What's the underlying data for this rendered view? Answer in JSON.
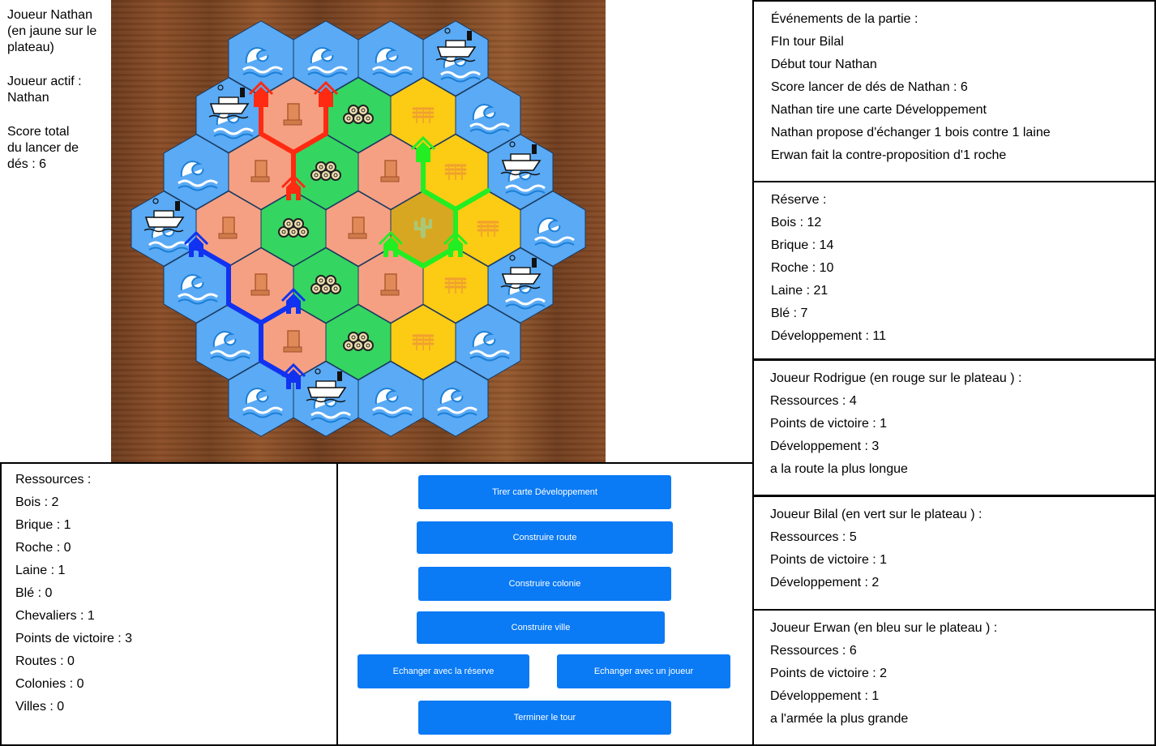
{
  "left_info": {
    "player": "Joueur Nathan\n(en jaune sur le\nplateau)",
    "active": "Joueur actif :\nNathan",
    "score": "Score total\ndu lancer de\ndés : 6"
  },
  "events": {
    "title": "Événements de la partie :",
    "items": [
      "FIn tour Bilal",
      "Début tour Nathan",
      "Score lancer de dés de Nathan : 6",
      "Nathan tire une carte Développement",
      "Nathan propose d'échanger 1 bois contre 1 laine",
      "Erwan fait la contre-proposition d'1 roche"
    ]
  },
  "reserve": {
    "title": "Réserve :",
    "items": [
      "Bois : 12",
      "Brique : 14",
      "Roche : 10",
      "Laine : 21",
      "Blé : 7",
      "Développement : 11"
    ]
  },
  "players": [
    {
      "title": "Joueur Rodrigue (en rouge sur le plateau ) :",
      "items": [
        "Ressources : 4",
        "Points de victoire : 1",
        "Développement : 3",
        "a la route la plus longue"
      ]
    },
    {
      "title": "Joueur Bilal (en vert sur le plateau ) :",
      "items": [
        "Ressources : 5",
        "Points de victoire : 1",
        "Développement : 2"
      ]
    },
    {
      "title": "Joueur Erwan (en bleu sur le plateau ) :",
      "items": [
        "Ressources : 6",
        "Points de victoire : 2",
        "Développement : 1",
        "a l'armée la plus grande"
      ]
    }
  ],
  "resources": {
    "title": "Ressources :",
    "items": [
      "Bois : 2",
      "Brique : 1",
      "Roche : 0",
      "Laine : 1",
      "Blé : 0",
      "Chevaliers : 1",
      "Points de victoire : 3",
      "Routes : 0",
      "Colonies : 0",
      "Villes : 0"
    ]
  },
  "actions": {
    "draw_card": "Tirer carte Développement",
    "build_road": "Construire route",
    "build_colony": "Construire colonie",
    "build_city": "Construire ville",
    "trade_reserve": "Echanger avec la réserve",
    "trade_player": "Echanger avec un joueur",
    "end_turn": "Terminer le tour"
  },
  "board": {
    "colors": {
      "sea": "#5aaaf5",
      "brick": "#f6a083",
      "forest": "#35d561",
      "wheat": "#fccb14",
      "desert": "#d8a722",
      "red": "#ff2a12",
      "green": "#22ee22",
      "blue": "#1132f0"
    },
    "rows": [
      [
        "sea",
        "sea",
        "sea",
        "port"
      ],
      [
        "port",
        "brick",
        "forest",
        "wheat",
        "sea"
      ],
      [
        "sea",
        "brick",
        "forest",
        "brick",
        "wheat",
        "port"
      ],
      [
        "port",
        "brick",
        "forest",
        "brick",
        "desert",
        "wheat",
        "sea"
      ],
      [
        "sea",
        "brick",
        "forest",
        "brick",
        "wheat",
        "port"
      ],
      [
        "sea",
        "brick",
        "forest",
        "wheat",
        "sea"
      ],
      [
        "sea",
        "port",
        "sea",
        "sea"
      ]
    ]
  }
}
